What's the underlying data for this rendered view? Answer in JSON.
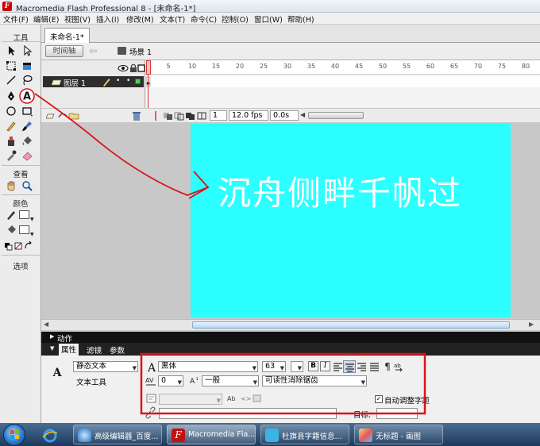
{
  "window": {
    "title": "Macromedia Flash Professional 8 - [未命名-1*]",
    "app_icon": "F"
  },
  "menu": [
    "文件(F)",
    "编辑(E)",
    "视图(V)",
    "插入(I)",
    "修改(M)",
    "文本(T)",
    "命令(C)",
    "控制(O)",
    "窗口(W)",
    "帮助(H)"
  ],
  "toolbox": {
    "tools_title": "工具",
    "view_title": "查看",
    "colors_title": "颜色",
    "options_title": "选项",
    "text_tool_glyph": "A"
  },
  "document": {
    "tab": "未命名-1*"
  },
  "scene_bar": {
    "timeline_button": "时间轴",
    "scene": "场景 1"
  },
  "timeline": {
    "layer": "图层 1",
    "frame_numbers": [
      "5",
      "10",
      "15",
      "20",
      "25",
      "30",
      "35",
      "40",
      "45",
      "50",
      "55",
      "60",
      "65",
      "70",
      "75",
      "80"
    ],
    "current_frame": "1",
    "fps": "12.0 fps",
    "time": "0.0s"
  },
  "stage": {
    "text": "沉舟侧畔千帆过",
    "background": "#2bffff"
  },
  "panels": {
    "actions": "动作",
    "properties": "属性",
    "filters": "滤镜",
    "parameters": "参数"
  },
  "properties": {
    "text_type": "静态文本",
    "tool_name": "文本工具",
    "font": "黑体",
    "font_size": "63",
    "bold": "B",
    "italic": "I",
    "letter_spacing": "0",
    "baseline": "一般",
    "anti_alias": "可读性消除锯齿",
    "auto_kern": "自动调整字距",
    "auto_kern_checked": true,
    "target_label": "目标:"
  },
  "taskbar": {
    "apps": [
      "高级编辑器_百度...",
      "Macromedia Fla...",
      "杜旗县字籍信息...",
      "无标题 - 画图"
    ]
  }
}
